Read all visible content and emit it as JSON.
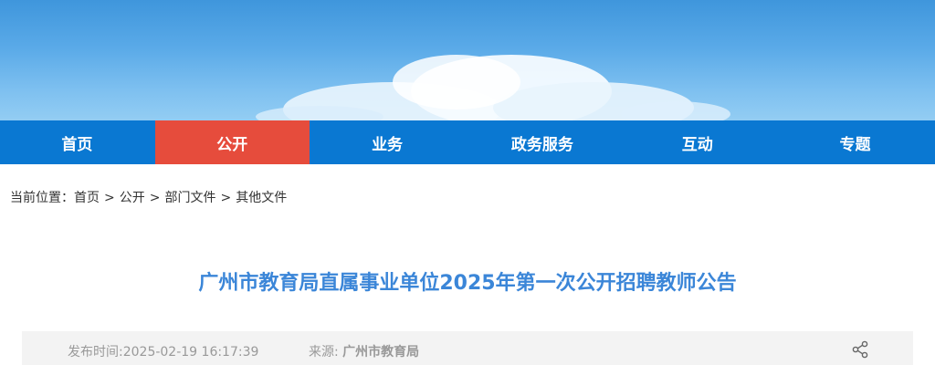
{
  "nav": {
    "items": [
      {
        "label": "首页"
      },
      {
        "label": "公开"
      },
      {
        "label": "业务"
      },
      {
        "label": "政务服务"
      },
      {
        "label": "互动"
      },
      {
        "label": "专题"
      }
    ],
    "active_index": 1
  },
  "breadcrumb": {
    "prefix": "当前位置：",
    "items": [
      "首页",
      "公开",
      "部门文件",
      "其他文件"
    ],
    "separator": ">"
  },
  "article": {
    "title": "广州市教育局直属事业单位2025年第一次公开招聘教师公告",
    "published_label": "发布时间:",
    "published_value": "2025-02-19 16:17:39",
    "source_label": "来源:",
    "source_value": "广州市教育局"
  },
  "icons": {
    "share": "share-icon"
  },
  "colors": {
    "nav_bg": "#0a78d2",
    "nav_active": "#e64c3c",
    "title": "#3b86d8"
  }
}
